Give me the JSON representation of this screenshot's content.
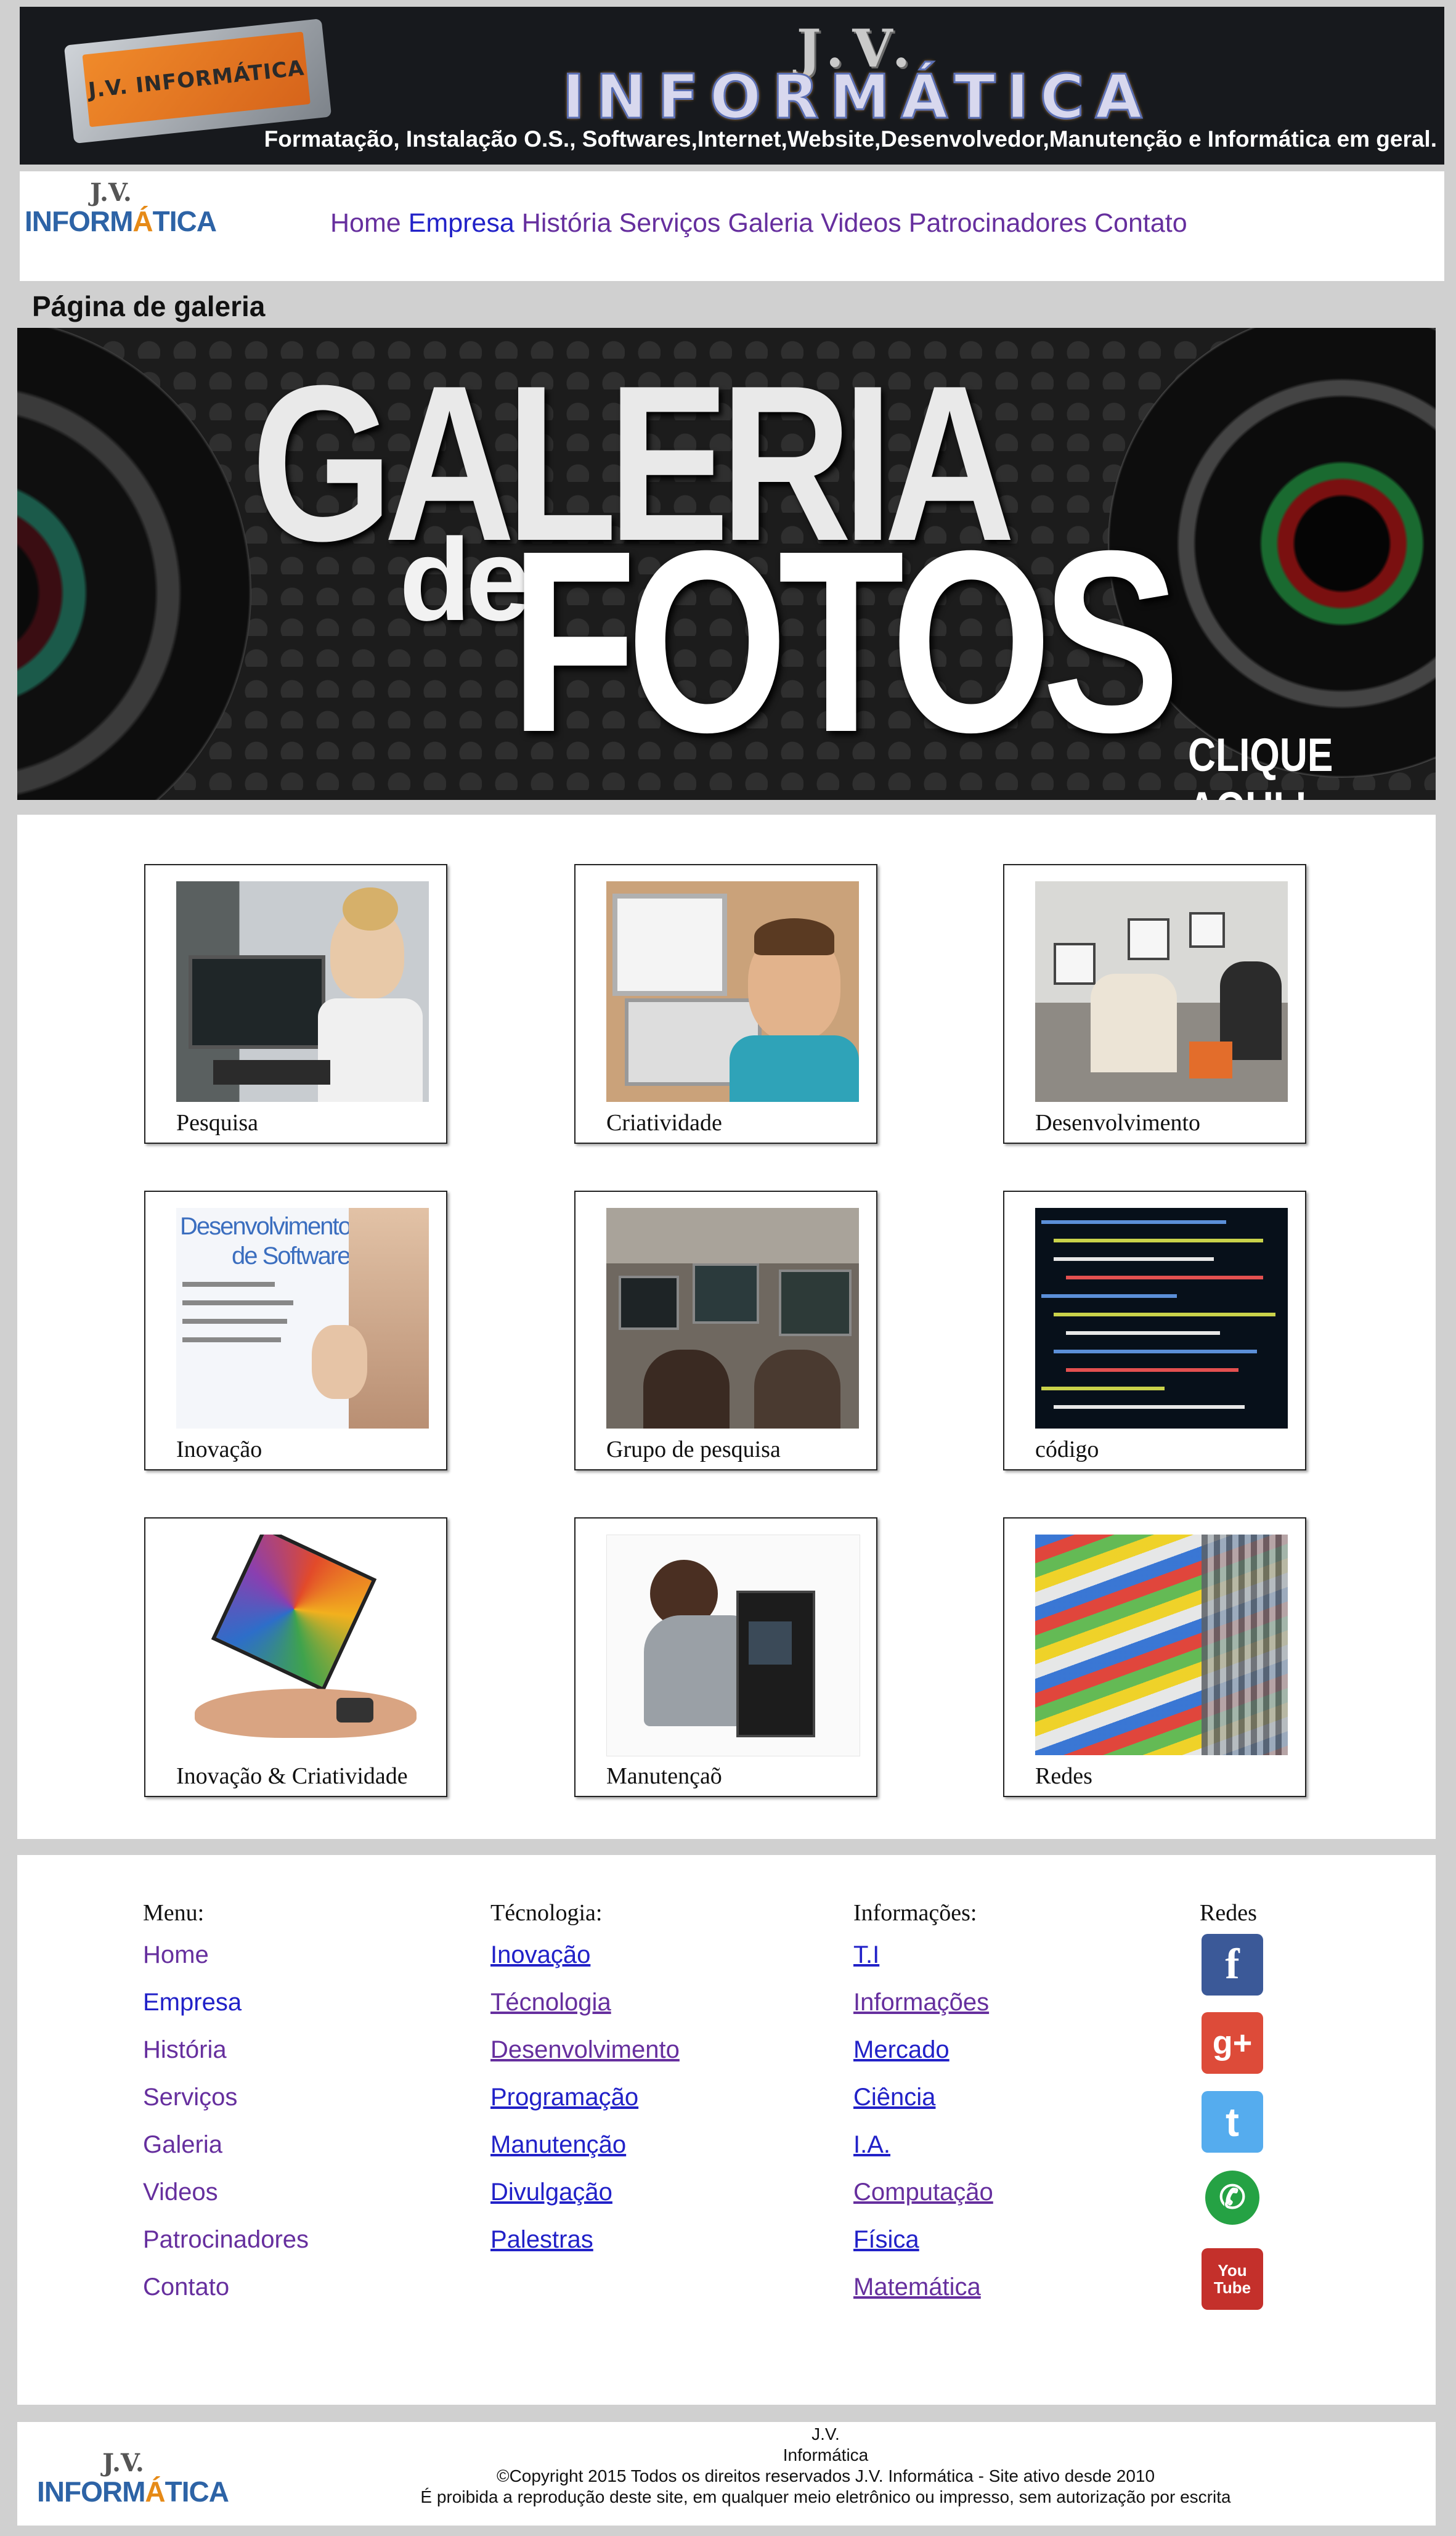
{
  "colors": {
    "page_bg": "#d0d0d0",
    "banner_bg": "#17191d",
    "nav_visited": "#662f9e",
    "nav_link": "#2121c8"
  },
  "banner": {
    "monitor_label": "J.V. INFORMÁTICA",
    "brand_line1": "J.V.",
    "brand_line2": "INFORMÁTICA",
    "tagline": "Formatação, Instalação O.S., Softwares,Internet,Website,Desenvolvedor,Manutenção e Informática em geral."
  },
  "logo": {
    "line1": "J.V.",
    "line2a": "INFORM",
    "line2b": "Á",
    "line2c": "TICA"
  },
  "nav": {
    "items": [
      {
        "label": "Home"
      },
      {
        "label": "Empresa"
      },
      {
        "label": "História"
      },
      {
        "label": "Serviços"
      },
      {
        "label": "Galeria"
      },
      {
        "label": "Videos"
      },
      {
        "label": "Patrocinadores"
      },
      {
        "label": "Contato"
      }
    ]
  },
  "page_heading": "Página de galeria",
  "hero": {
    "title_line1": "GALERIA",
    "title_de": "de",
    "title_line2": "FOTOS",
    "cta": "CLIQUE AQUI !"
  },
  "gallery": [
    {
      "caption": "Pesquisa"
    },
    {
      "caption": "Criatividade"
    },
    {
      "caption": "Desenvolvimento"
    },
    {
      "caption": "Inovação"
    },
    {
      "caption": "Grupo de pesquisa"
    },
    {
      "caption": "código"
    },
    {
      "caption": "Inovação & Criatividade"
    },
    {
      "caption": "Manutençaõ"
    },
    {
      "caption": "Redes"
    }
  ],
  "gallery_image_text": {
    "software_title_1": "Desenvolvimento",
    "software_title_2": "de Software"
  },
  "footer": {
    "menu_title": "Menu:",
    "menu_links": [
      "Home",
      "Empresa",
      "História",
      "Serviços",
      "Galeria",
      "Videos",
      "Patrocinadores",
      "Contato"
    ],
    "tech_title": "Técnologia:",
    "tech_links": [
      "Inovação",
      "Técnologia",
      "Desenvolvimento",
      "Programação",
      "Manutenção",
      "Divulgação",
      "Palestras"
    ],
    "info_title": "Informações:",
    "info_links": [
      "T.I",
      "Informações",
      "Mercado",
      "Ciência",
      "I.A.",
      "Computação",
      "Física",
      "Matemática"
    ],
    "social_title": "Redes",
    "social": [
      {
        "icon": "facebook-icon",
        "glyph": "f",
        "color": "#3b5998"
      },
      {
        "icon": "google-plus-icon",
        "glyph": "g+",
        "color": "#dd4b39"
      },
      {
        "icon": "twitter-icon",
        "glyph": "t",
        "color": "#55acee"
      },
      {
        "icon": "whatsapp-icon",
        "glyph": "✆",
        "color": "#25a244"
      },
      {
        "icon": "youtube-icon",
        "glyph": "You Tube",
        "color": "#c4302b"
      }
    ]
  },
  "bottom": {
    "line1": "J.V.",
    "line2": "Informática",
    "copyright": "©Copyright 2015 Todos os direitos reservados J.V. Informática - Site ativo desde 2010",
    "notice": "É proibida a reprodução deste site, em qualquer meio eletrônico ou impresso, sem autorização por escrita"
  }
}
